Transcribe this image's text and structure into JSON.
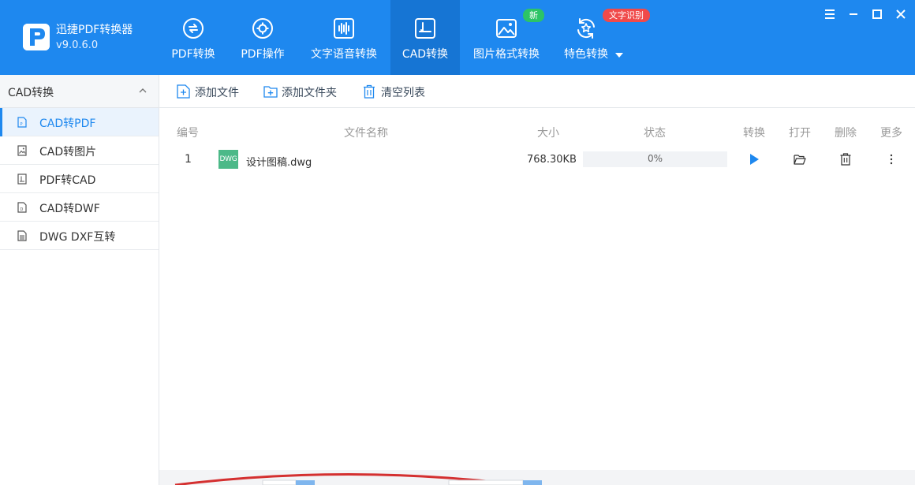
{
  "app": {
    "name": "迅捷PDF转换器",
    "version": "v9.0.6.0"
  },
  "nav": {
    "tabs": [
      {
        "label": "PDF转换",
        "icon": "refresh-doc-icon"
      },
      {
        "label": "PDF操作",
        "icon": "gear-circle-icon"
      },
      {
        "label": "文字语音转换",
        "icon": "audio-wave-icon"
      },
      {
        "label": "CAD转换",
        "icon": "cad-icon",
        "active": true
      },
      {
        "label": "图片格式转换",
        "icon": "image-icon"
      },
      {
        "label": "特色转换",
        "icon": "star-cycle-icon"
      }
    ],
    "badge_new": "新",
    "badge_ocr": "文字识别"
  },
  "sidebar": {
    "title": "CAD转换",
    "items": [
      {
        "label": "CAD转PDF",
        "active": true
      },
      {
        "label": "CAD转图片"
      },
      {
        "label": "PDF转CAD"
      },
      {
        "label": "CAD转DWF"
      },
      {
        "label": "DWG DXF互转"
      }
    ]
  },
  "toolbar": {
    "add_file": "添加文件",
    "add_folder": "添加文件夹",
    "clear_list": "清空列表"
  },
  "table": {
    "headers": {
      "index": "编号",
      "name": "文件名称",
      "size": "大小",
      "status": "状态",
      "convert": "转换",
      "open": "打开",
      "delete": "删除",
      "more": "更多"
    },
    "rows": [
      {
        "index": "1",
        "thumb": "DWG",
        "name": "设计图稿.dwg",
        "size": "768.30KB",
        "progress_text": "0%",
        "progress": 0
      }
    ]
  },
  "colors": {
    "brand": "#1e88ef",
    "active_tab": "#1675d4",
    "badge_new": "#2cc466",
    "badge_ocr": "#f04a4a",
    "file_thumb": "#4cb988"
  }
}
